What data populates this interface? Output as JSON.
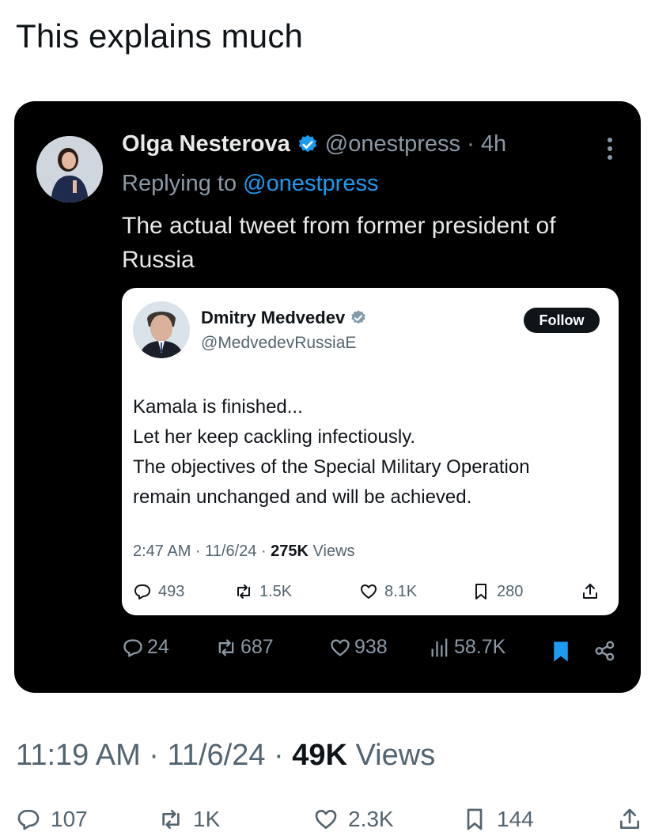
{
  "post": {
    "text": "This explains much"
  },
  "embedded_tweet": {
    "author_name": "Olga Nesterova",
    "handle_time": "@onestpress · 4h",
    "replying_prefix": "Replying to ",
    "replying_mention": "@onestpress",
    "body": "The actual tweet from former president of Russia",
    "quoted": {
      "author_name": "Dmitry Medvedev",
      "handle": "@MedvedevRussiaE",
      "follow_label": "Follow",
      "lines": [
        "Kamala is finished...",
        "Let her keep cackling infectiously.",
        "The objectives of the Special Military Operation",
        "remain unchanged and will be achieved."
      ],
      "meta_prefix": "2:47 AM · 11/6/24 · ",
      "views_count": "275K",
      "views_label": " Views",
      "replies": "493",
      "reposts": "1.5K",
      "likes": "8.1K",
      "bookmarks": "280"
    },
    "replies": "24",
    "reposts": "687",
    "likes": "938",
    "views": "58.7K"
  },
  "footer": {
    "meta_prefix": "11:19 AM · 11/6/24 · ",
    "views_count": "49K",
    "views_label": " Views",
    "replies": "107",
    "reposts": "1K",
    "likes": "2.3K",
    "bookmarks": "144"
  },
  "colors": {
    "accent_blue": "#1d9bf0",
    "dark_bg": "#000000",
    "muted_dark": "#8b98a5",
    "muted_light": "#536471"
  },
  "icons": [
    "more-icon",
    "verified-icon",
    "reply-icon",
    "repost-icon",
    "like-icon",
    "bookmark-icon",
    "share-icon",
    "views-icon"
  ]
}
